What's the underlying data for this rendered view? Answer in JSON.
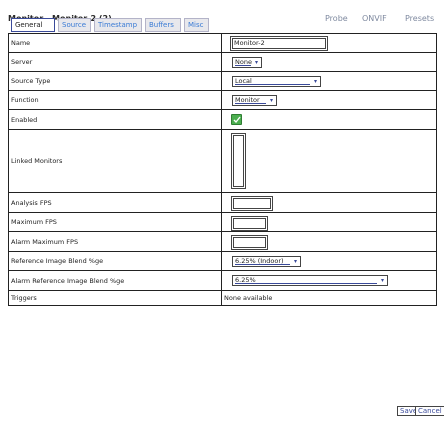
{
  "header": {
    "title": "Monitor - Monitor-2 (2)",
    "links": [
      "Probe",
      "ONVIF",
      "Presets"
    ]
  },
  "tabs": [
    {
      "label": "General",
      "active": true
    },
    {
      "label": "Source",
      "active": false
    },
    {
      "label": "Timestamp",
      "active": false
    },
    {
      "label": "Buffers",
      "active": false
    },
    {
      "label": "Misc",
      "active": false
    }
  ],
  "form": {
    "name": {
      "label": "Name",
      "value": "Monitor-2"
    },
    "server": {
      "label": "Server",
      "value": "None"
    },
    "source_type": {
      "label": "Source Type",
      "value": "Local"
    },
    "function": {
      "label": "Function",
      "value": "Monitor"
    },
    "enabled": {
      "label": "Enabled",
      "checked": true
    },
    "linked_monitors": {
      "label": "Linked Monitors"
    },
    "analysis_fps": {
      "label": "Analysis FPS",
      "value": ""
    },
    "maximum_fps": {
      "label": "Maximum FPS",
      "value": ""
    },
    "alarm_maximum_fps": {
      "label": "Alarm Maximum FPS",
      "value": ""
    },
    "ref_blend": {
      "label": "Reference Image Blend %ge",
      "value": "6.25% (Indoor)"
    },
    "alarm_ref_blend": {
      "label": "Alarm Reference Image Blend %ge",
      "value": "6.25%"
    },
    "triggers": {
      "label": "Triggers",
      "value": "None available"
    }
  },
  "buttons": {
    "save": "Save",
    "cancel": "Cancel"
  },
  "colors": {
    "link": "#3a7bd5",
    "check": "#4caf50",
    "border": "#222222"
  }
}
